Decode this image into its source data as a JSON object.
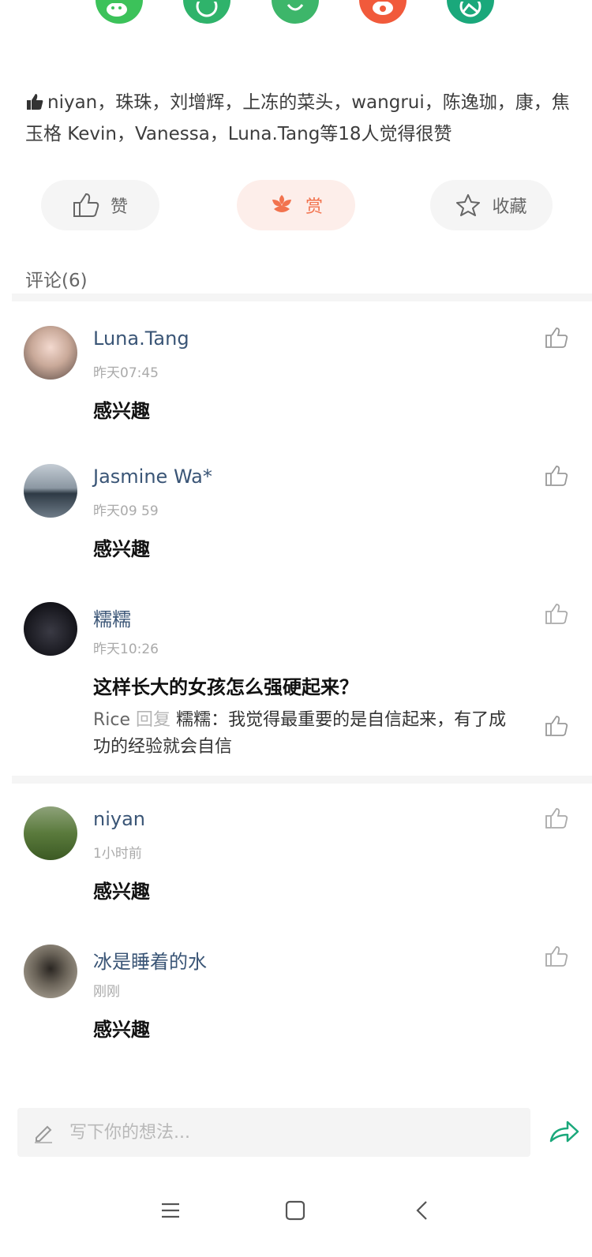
{
  "share_targets": [
    {
      "icon": "wechat-icon",
      "color": "#3cc25a"
    },
    {
      "icon": "moments-icon",
      "color": "#2fb36b"
    },
    {
      "icon": "link-icon",
      "color": "#3db66a"
    },
    {
      "icon": "weibo-icon",
      "color": "#f15a3b"
    },
    {
      "icon": "image-share-icon",
      "color": "#1aa87b"
    }
  ],
  "likes_summary": "niyan，珠珠，刘增辉，上冻的菜头，wangrui，陈逸珈，康，焦玉格 Kevin，Vanessa，Luna.Tang等18人觉得很赞",
  "actions": {
    "like_label": "赞",
    "reward_label": "赏",
    "favorite_label": "收藏"
  },
  "comments_header": "评论(6)",
  "comments": [
    {
      "name": "Luna.Tang",
      "time": "昨天07:45",
      "text": "感兴趣"
    },
    {
      "name": "Jasmine Wa*",
      "time": "昨天09 59",
      "text": "感兴趣"
    },
    {
      "name": "糯糯",
      "time": "昨天10:26",
      "text": "这样长大的女孩怎么强硬起来？",
      "reply": {
        "from": "Rice",
        "verb": "回复",
        "to": "糯糯",
        "text": "：我觉得最重要的是自信起来，有了成功的经验就会自信"
      }
    },
    {
      "name": "niyan",
      "time": "1小时前",
      "text": "感兴趣"
    },
    {
      "name": "冰是睡着的水",
      "time": "刚刚",
      "text": "感兴趣"
    }
  ],
  "input": {
    "placeholder": "写下你的想法..."
  },
  "colors": {
    "accent": "#f2734e",
    "name": "#3a5576",
    "green": "#1aa87b"
  }
}
